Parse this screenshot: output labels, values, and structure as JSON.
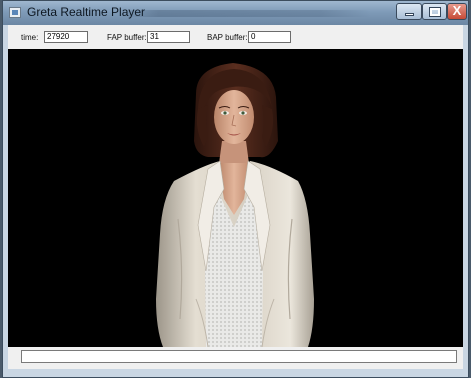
{
  "window": {
    "title": "Greta Realtime Player",
    "controls": {
      "minimize": "minimize",
      "maximize": "maximize",
      "close": "X"
    }
  },
  "toolbar": {
    "time_label": "time:",
    "time_value": "27920",
    "fap_label": "FAP buffer:",
    "fap_value": "31",
    "bap_label": "BAP buffer:",
    "bap_value": "0"
  },
  "status": {
    "input_value": ""
  },
  "colors": {
    "viewport_bg": "#000000",
    "jacket": "#ddd7cb",
    "hair": "#4a2418",
    "skin": "#d9a98e"
  }
}
